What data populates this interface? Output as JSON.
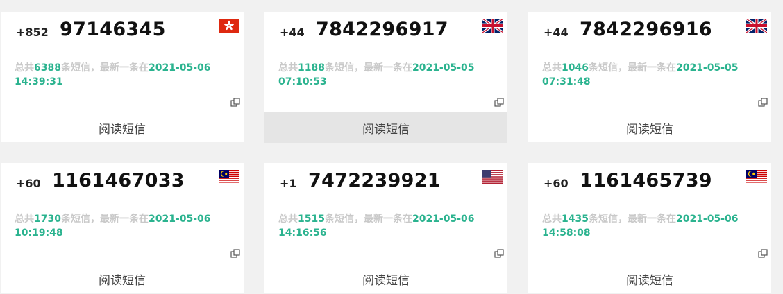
{
  "read_label": "阅读短信",
  "info_prefix": "总共",
  "info_mid": "条短信，最新一条在",
  "colors": {
    "accent": "#2bb38f",
    "muted": "#c9c9c9",
    "active_button": "#e5e5e5"
  },
  "cards": [
    {
      "code": "+852",
      "number": "97146345",
      "count": "6388",
      "date": "2021-05-06",
      "time": "14:39:31",
      "flag": "hong-kong"
    },
    {
      "code": "+44",
      "number": "7842296917",
      "count": "1188",
      "date": "2021-05-05",
      "time": "07:10:53",
      "flag": "united-kingdom"
    },
    {
      "code": "+44",
      "number": "7842296916",
      "count": "1046",
      "date": "2021-05-05",
      "time": "07:31:48",
      "flag": "united-kingdom"
    },
    {
      "code": "+60",
      "number": "1161467033",
      "count": "1730",
      "date": "2021-05-06",
      "time": "10:19:48",
      "flag": "malaysia"
    },
    {
      "code": "+1",
      "number": "7472239921",
      "count": "1515",
      "date": "2021-05-06",
      "time": "14:16:56",
      "flag": "united-states"
    },
    {
      "code": "+60",
      "number": "1161465739",
      "count": "1435",
      "date": "2021-05-06",
      "time": "14:58:08",
      "flag": "malaysia"
    }
  ]
}
